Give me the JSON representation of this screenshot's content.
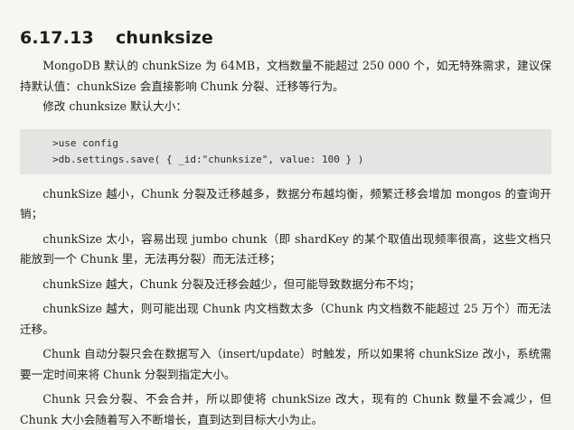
{
  "section": {
    "number": "6.17.13",
    "title": "chunksize"
  },
  "paragraphs": {
    "intro": "MongoDB 默认的 chunkSize 为 64MB，文档数量不能超过 250 000 个，如无特殊需求，建议保持默认值：chunkSize 会直接影响 Chunk 分裂、迁移等行为。",
    "modify": "修改 chunksize 默认大小："
  },
  "code": {
    "line1": ">use config",
    "line2": ">db.settings.save( { _id:\"chunksize\", value: 100 } )"
  },
  "points": [
    "chunkSize 越小，Chunk 分裂及迁移越多，数据分布越均衡，频繁迁移会增加 mongos 的查询开销；",
    "chunkSize 太小，容易出现 jumbo chunk（即 shardKey 的某个取值出现频率很高，这些文档只能放到一个 Chunk 里，无法再分裂）而无法迁移；",
    "chunkSize 越大，Chunk 分裂及迁移会越少，但可能导致数据分布不均；",
    "chunkSize 越大，则可能出现 Chunk 内文档数太多（Chunk 内文档数不能超过 25 万个）而无法迁移。",
    "Chunk 自动分裂只会在数据写入（insert/update）时触发，所以如果将 chunkSize 改小，系统需要一定时间来将 Chunk 分裂到指定大小。",
    "Chunk 只会分裂、不会合并，所以即使将 chunkSize 改大，现有的 Chunk 数量不会减少，但 Chunk 大小会随着写入不断增长，直到达到目标大小为止。"
  ]
}
